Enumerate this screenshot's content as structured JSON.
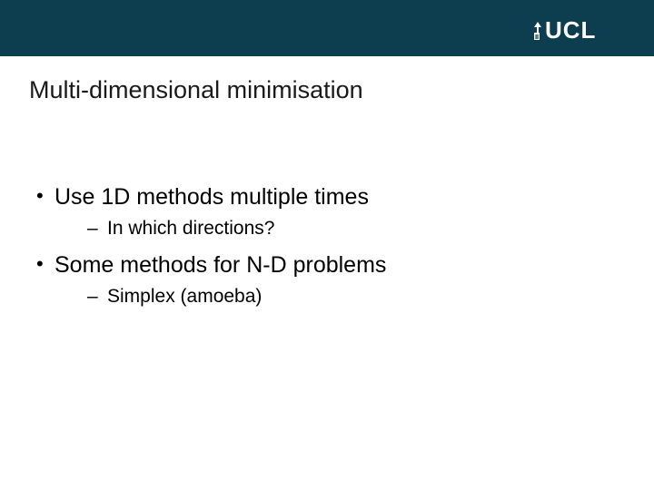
{
  "header": {
    "logo_text": "UCL"
  },
  "slide": {
    "title": "Multi-dimensional minimisation",
    "bullets": [
      {
        "text": "Use 1D methods multiple times",
        "sub": [
          "In which directions?"
        ]
      },
      {
        "text": "Some methods for N-D problems",
        "sub": [
          "Simplex (amoeba)"
        ]
      }
    ]
  }
}
